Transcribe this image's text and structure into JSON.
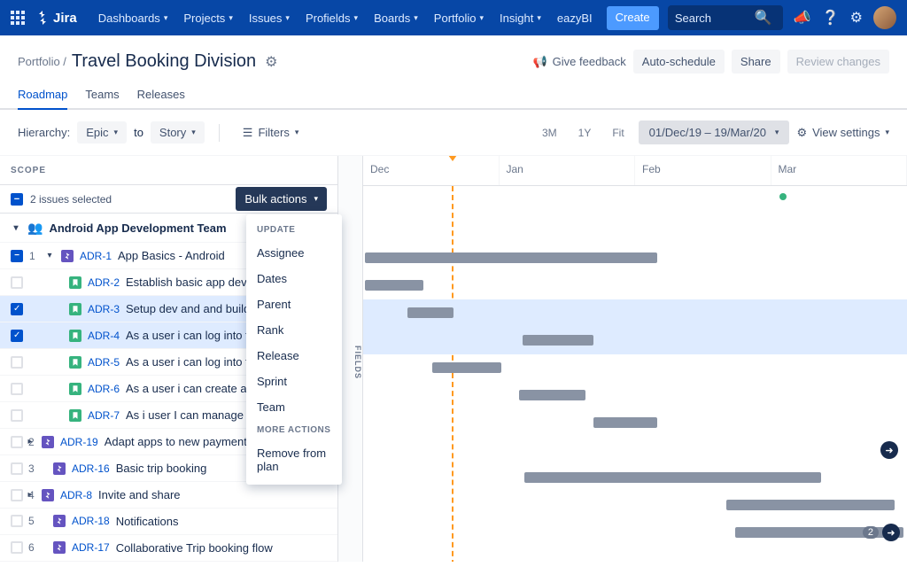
{
  "nav": {
    "brand": "Jira",
    "items": [
      "Dashboards",
      "Projects",
      "Issues",
      "Profields",
      "Boards",
      "Portfolio",
      "Insight",
      "eazyBI"
    ],
    "create": "Create",
    "search_ph": "Search"
  },
  "page": {
    "breadcrumb": "Portfolio /",
    "title": "Travel Booking Division",
    "feedback": "Give feedback",
    "auto_schedule": "Auto-schedule",
    "share": "Share",
    "review": "Review changes"
  },
  "tabs": {
    "roadmap": "Roadmap",
    "teams": "Teams",
    "releases": "Releases"
  },
  "filter": {
    "hierarchy": "Hierarchy:",
    "epic": "Epic",
    "to": "to",
    "story": "Story",
    "filters": "Filters",
    "zoom_3m": "3M",
    "zoom_1y": "1Y",
    "zoom_fit": "Fit",
    "range": "01/Dec/19 – 19/Mar/20",
    "view": "View settings"
  },
  "scope": {
    "label": "SCOPE",
    "fields": "FIELDS",
    "selected": "2 issues selected",
    "bulk": "Bulk actions"
  },
  "dropdown": {
    "update": "UPDATE",
    "assignee": "Assignee",
    "dates": "Dates",
    "parent": "Parent",
    "rank": "Rank",
    "release": "Release",
    "sprint": "Sprint",
    "team": "Team",
    "more": "MORE ACTIONS",
    "remove": "Remove from plan"
  },
  "timeline": {
    "months": [
      "Dec",
      "Jan",
      "Feb",
      "Mar"
    ]
  },
  "rows": {
    "team": "Android App Development Team",
    "r1_key": "ADR-1",
    "r1_sum": "App Basics - Android",
    "r2_key": "ADR-2",
    "r2_sum": "Establish basic app dev framework",
    "r3_key": "ADR-3",
    "r3_sum": "Setup dev and and build environment",
    "r4_key": "ADR-4",
    "r4_sum": "As a user i can log into the app",
    "r5_key": "ADR-5",
    "r5_sum": "As a user i can log into the app",
    "r6_key": "ADR-6",
    "r6_sum": "As a user i can create a customer",
    "r7_key": "ADR-7",
    "r7_sum": "As i user I can manage my profile",
    "r8_key": "ADR-19",
    "r8_sum": "Adapt apps to new payment methods",
    "r9_key": "ADR-16",
    "r9_sum": "Basic trip booking",
    "r10_key": "ADR-8",
    "r10_sum": "Invite and share",
    "r11_key": "ADR-18",
    "r11_sum": "Notifications",
    "r12_key": "ADR-17",
    "r12_sum": "Collaborative Trip booking flow",
    "n1": "1",
    "n2": "2",
    "n3": "3",
    "n4": "4",
    "n5": "5",
    "n6": "6",
    "badge2": "2"
  }
}
